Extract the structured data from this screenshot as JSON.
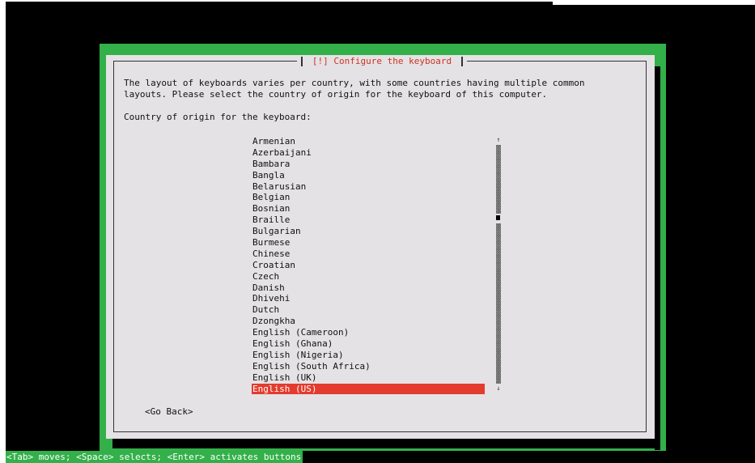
{
  "dialog": {
    "title": "[!] Configure the keyboard",
    "description_line1": "The layout of keyboards varies per country, with some countries having multiple common",
    "description_line2": "layouts. Please select the country of origin for the keyboard of this computer.",
    "prompt": "Country of origin for the keyboard:",
    "back_label": "<Go Back>"
  },
  "list": {
    "items": [
      "Armenian",
      "Azerbaijani",
      "Bambara",
      "Bangla",
      "Belarusian",
      "Belgian",
      "Bosnian",
      "Braille",
      "Bulgarian",
      "Burmese",
      "Chinese",
      "Croatian",
      "Czech",
      "Danish",
      "Dhivehi",
      "Dutch",
      "Dzongkha",
      "English (Cameroon)",
      "English (Ghana)",
      "English (Nigeria)",
      "English (South Africa)",
      "English (UK)",
      "English (US)"
    ],
    "selected": "English (US)"
  },
  "scrollbar": {
    "up_icon": "↑",
    "down_icon": "↓"
  },
  "status": {
    "help": "<Tab> moves; <Space> selects; <Enter> activates buttons"
  },
  "colors": {
    "frame_green": "#33b04a",
    "dialog_bg": "#e5e2e5",
    "title_red": "#cc3322",
    "selection_red": "#e33b2e"
  }
}
